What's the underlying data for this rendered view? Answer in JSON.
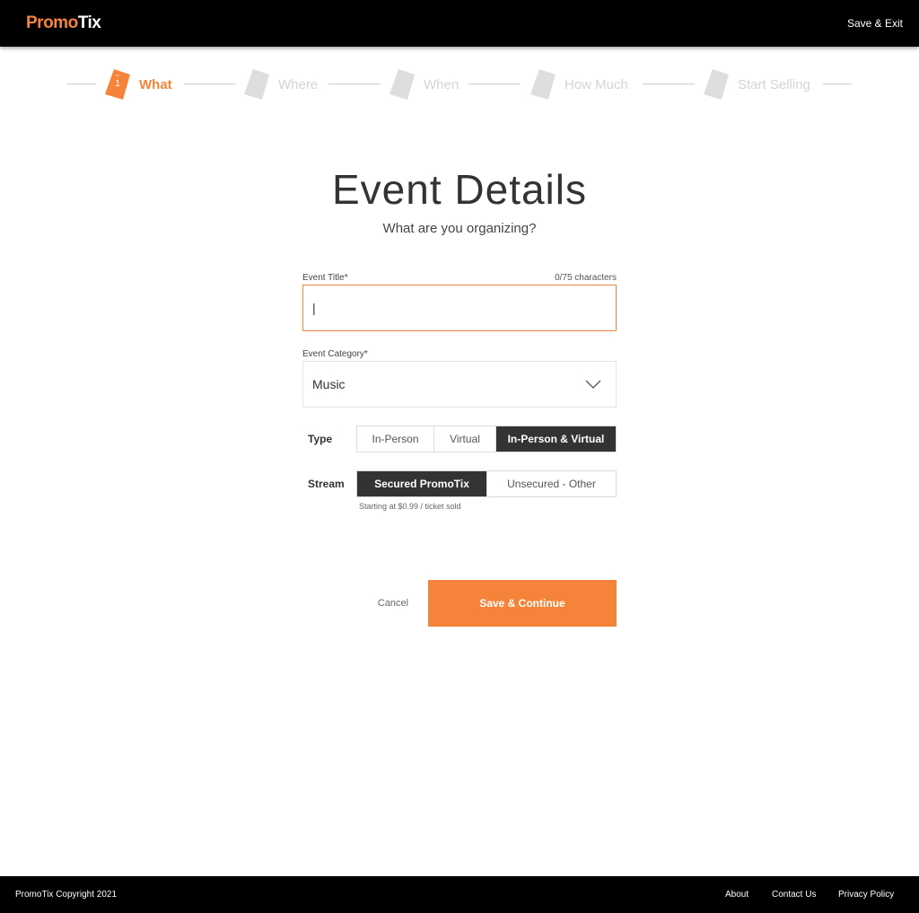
{
  "header": {
    "logo_part1": "Promo",
    "logo_part2": "Tix",
    "save_exit_label": "Save & Exit"
  },
  "steps": [
    {
      "number": "1",
      "label": "What",
      "active": true
    },
    {
      "number": "",
      "label": "Where",
      "active": false
    },
    {
      "number": "",
      "label": "When",
      "active": false
    },
    {
      "number": "",
      "label": "How Much",
      "active": false
    },
    {
      "number": "",
      "label": "Start Selling",
      "active": false
    }
  ],
  "main": {
    "title": "Event Details",
    "subtitle": "What are you organizing?",
    "event_title": {
      "label": "Event Title*",
      "counter": "0/75 characters",
      "value": "|"
    },
    "event_category": {
      "label": "Event Category*",
      "value": "Music"
    },
    "type": {
      "label": "Type",
      "options": [
        "In-Person",
        "Virtual",
        "In-Person & Virtual"
      ],
      "selected": "In-Person & Virtual"
    },
    "stream": {
      "label": "Stream",
      "options": [
        "Secured PromoTix",
        "Unsecured - Other"
      ],
      "selected": "Secured PromoTix",
      "note": "Starting at $0.99 / ticket sold"
    },
    "cancel_label": "Cancel",
    "save_continue_label": "Save & Continue"
  },
  "footer": {
    "copyright": "PromoTix Copyright 2021",
    "links": [
      "About",
      "Contact Us",
      "Privacy Policy"
    ]
  },
  "colors": {
    "accent": "#f5843a",
    "dark": "#333333",
    "inactive_step": "#d4d4d4"
  }
}
